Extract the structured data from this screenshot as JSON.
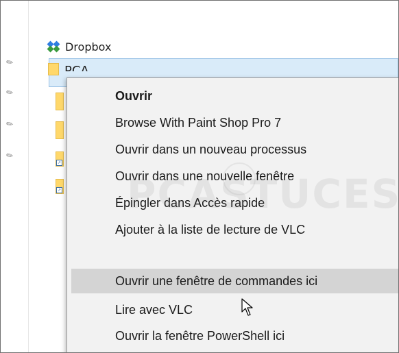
{
  "explorer": {
    "truncated_top_label": "",
    "items": [
      {
        "label": "Dropbox",
        "icon": "dropbox-icon"
      },
      {
        "label": "PCA",
        "icon": "folder-icon",
        "selected": true
      }
    ],
    "pins": [
      "pin-icon",
      "pin-icon",
      "pin-icon",
      "pin-icon"
    ]
  },
  "context_menu": {
    "items": [
      {
        "label": "Ouvrir",
        "default": true
      },
      {
        "label": "Browse With Paint Shop Pro 7"
      },
      {
        "label": "Ouvrir dans un nouveau processus"
      },
      {
        "label": "Ouvrir dans une nouvelle fenêtre"
      },
      {
        "label": "Épingler dans Accès rapide"
      },
      {
        "label": "Ajouter à la liste de lecture de VLC"
      },
      {
        "label": "Ouvrir une fenêtre de commandes ici",
        "hovered": true
      },
      {
        "label": "Lire avec VLC"
      },
      {
        "label": "Ouvrir la fenêtre PowerShell ici"
      }
    ]
  },
  "watermark": {
    "text": "PCASTUCES"
  },
  "colors": {
    "selection_bg": "#d9ebf9",
    "selection_border": "#9bc3e6",
    "menu_bg": "#f2f2f2",
    "menu_hover": "#d4d4d4",
    "folder": "#ffd86b"
  }
}
